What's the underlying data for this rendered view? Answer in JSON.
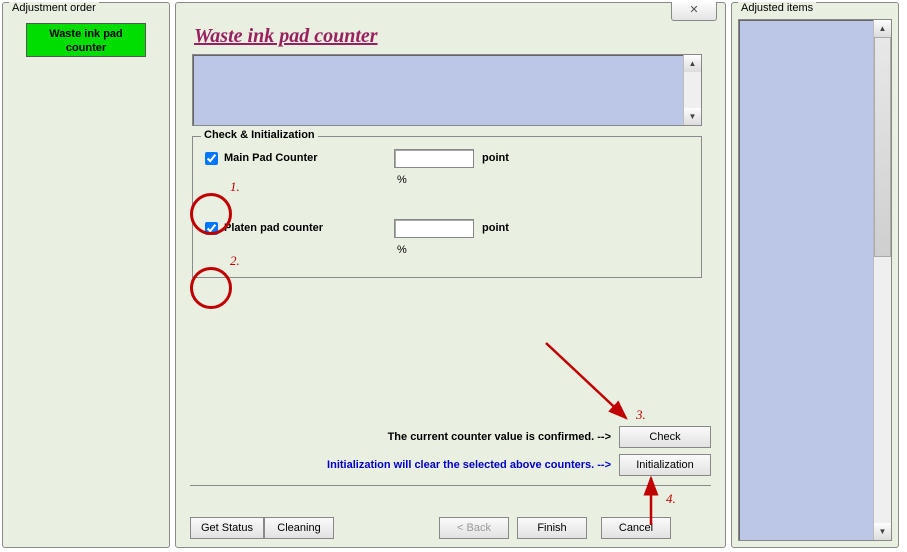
{
  "left": {
    "title": "Adjustment order",
    "button": "Waste ink pad counter"
  },
  "center": {
    "close_glyph": "✕",
    "title": "Waste ink pad counter",
    "group_legend": "Check & Initialization",
    "main": {
      "label": "Main Pad Counter",
      "checked": true,
      "point_value": "",
      "point_unit": "point",
      "pct_value": "",
      "pct_unit": "%"
    },
    "platen": {
      "label": "Platen pad counter",
      "checked": true,
      "point_value": "",
      "point_unit": "point",
      "pct_value": "",
      "pct_unit": "%"
    },
    "confirm_msg": "The current counter value is confirmed. -->",
    "check_btn": "Check",
    "init_msg": "Initialization will clear the selected above counters. -->",
    "init_btn": "Initialization",
    "bottom": {
      "get_status": "Get Status",
      "cleaning": "Cleaning",
      "back": "< Back",
      "finish": "Finish",
      "cancel": "Cancel"
    }
  },
  "right": {
    "title": "Adjusted items"
  },
  "annotations": {
    "n1": "1.",
    "n2": "2.",
    "n3": "3.",
    "n4": "4."
  }
}
